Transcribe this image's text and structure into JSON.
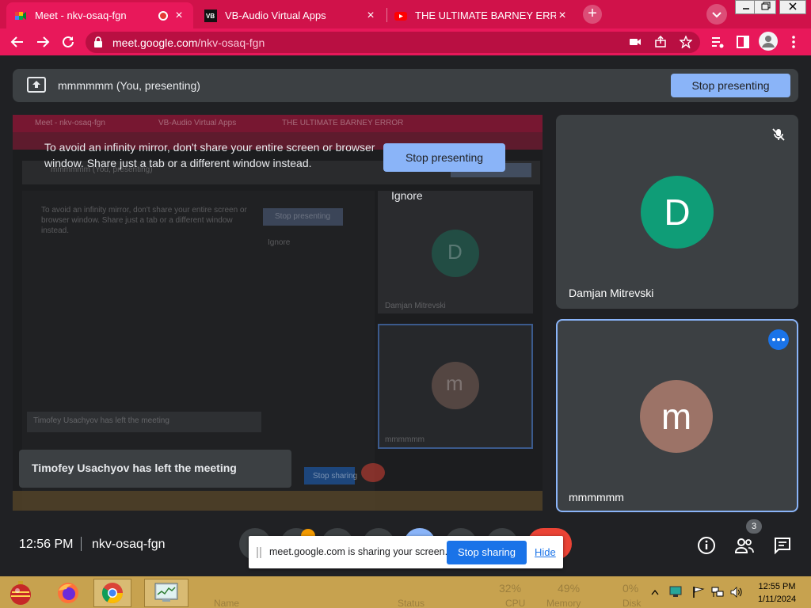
{
  "browser": {
    "tabs": [
      {
        "title": "Meet - nkv-osaq-fgn",
        "active": true
      },
      {
        "title": "VB-Audio Virtual Apps",
        "active": false
      },
      {
        "title": "THE ULTIMATE BARNEY ERROR -",
        "active": false
      }
    ],
    "url_host": "meet.google.com",
    "url_path": "/nkv-osaq-fgn",
    "accent_color": "#e8185a"
  },
  "presenting_bar": {
    "text": "mmmmmm (You, presenting)",
    "stop_label": "Stop presenting"
  },
  "infinity_mirror": {
    "message": "To avoid an infinity mirror, don't share your entire screen or browser window. Share just a tab or a different window instead.",
    "stop_label": "Stop presenting",
    "ignore_label": "Ignore"
  },
  "mirror_ghost": {
    "tab1": "Meet - nkv-osaq-fgn",
    "tab2": "VB-Audio Virtual Apps",
    "tab3": "THE ULTIMATE BARNEY ERROR",
    "presenting": "mmmmmm (You, presenting)",
    "stop": "Stop presenting",
    "message": "To avoid an infinity mirror, don't share your entire screen or browser window. Share just a tab or a different window instead.",
    "ignore": "Ignore",
    "tile1_letter": "D",
    "tile1_name": "Damjan Mitrevski",
    "tile2_letter": "m",
    "tile2_name": "mmmmmm",
    "left_msg": "Timofey Usachyov has left the meeting",
    "stop_sharing": "Stop sharing"
  },
  "participants": [
    {
      "name": "Damjan Mitrevski",
      "initial": "D",
      "avatar_color": "#0f9d77",
      "muted": true
    },
    {
      "name": "mmmmmm",
      "initial": "m",
      "avatar_color": "#9c7367",
      "muted": false
    }
  ],
  "toast": {
    "text": "Timofey Usachyov has left the meeting"
  },
  "footer": {
    "time": "12:56 PM",
    "meeting_code": "nkv-osaq-fgn",
    "participant_count": "3"
  },
  "share_notice": {
    "message": "meet.google.com is sharing your screen.",
    "stop_label": "Stop sharing",
    "hide_label": "Hide"
  },
  "taskbar": {
    "time": "12:55 PM",
    "date": "1/11/2024",
    "ghost": {
      "cpu": "32%",
      "cpu_label": "CPU",
      "memory": "49%",
      "memory_label": "Memory",
      "disk": "0%",
      "disk_label": "Disk",
      "name_label": "Name",
      "status_label": "Status"
    }
  }
}
